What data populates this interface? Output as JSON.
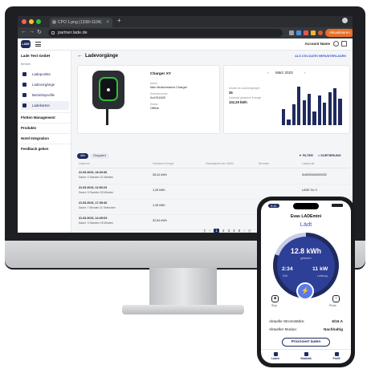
{
  "browser": {
    "tab_title": "CPO 1.png (1338×1104)",
    "tab_close": "×",
    "new_tab": "+",
    "url": "partner.lade.de",
    "update_label": "Aktualisieren"
  },
  "app": {
    "logo_text": "LADE",
    "account": "Account Name"
  },
  "sidebar": {
    "company": "Lade Test GmbH",
    "section_label": "Betrieb",
    "items": [
      {
        "label": "Ladepunkte",
        "icon": "charger-icon"
      },
      {
        "label": "Ladevorgänge",
        "icon": "list-icon"
      },
      {
        "label": "Betriebsprofile",
        "icon": "power-icon"
      },
      {
        "label": "Ladekarten",
        "icon": "card-icon"
      }
    ],
    "groups": [
      "Flotten Management",
      "Produkte",
      "Hotel Integration",
      "Feedback geben"
    ]
  },
  "main": {
    "title": "Ladevorgänge",
    "csv_link": "ALS CSV-DATEI HERUNTERLADEN",
    "charger": {
      "name": "Charger XY",
      "fields": [
        {
          "label": "Name",
          "value": "Max Mustermanns Charger"
        },
        {
          "label": "Seriennummer",
          "value": "0x4761625"
        },
        {
          "label": "Status",
          "value": "Offline"
        }
      ]
    },
    "stats": {
      "count_label": "Anzahl an Ladevorgängen",
      "count_value": "35",
      "energy_label": "Gesamte geladene Energie",
      "energy_value": "102,29 kWh",
      "month": "März 2023",
      "prev": "‹",
      "next": "›"
    },
    "chips": [
      "Alle",
      "Gruppiert"
    ],
    "filter_label": "FILTER",
    "sort_label": "SORTIERUNG",
    "table": {
      "headers": [
        "Zeitpunkt",
        "Geladene Energie",
        "Gesamtpreis inkl. MwSt.",
        "Benutzer",
        "Ladepunkt"
      ],
      "rows": [
        {
          "date": "21.03.2023, 18:20:36",
          "duration": "Dauer: 4 Stunden 21 Minuten",
          "energy": "28,44 kWh",
          "point": "0x5925340000025"
        },
        {
          "date": "21.03.2023, 11:53:23",
          "duration": "Dauer: 5 Stunden 33 Minuten",
          "energy": "1,26 kWh",
          "point": "LADE Go 3"
        },
        {
          "date": "21.03.2023, 17:39:40",
          "duration": "Dauer: 7 Minuten 21 Sekunden",
          "energy": "1,26 kWh",
          "point": "LADE Go 1"
        },
        {
          "date": "21.03.2023, 14:29:03",
          "duration": "Dauer: 3 Stunden 15 Minuten",
          "energy": "32,64 kWh",
          "point": ""
        }
      ]
    },
    "pager": [
      "|‹",
      "‹",
      "1",
      "2",
      "3",
      "4",
      "5",
      "›",
      "›|"
    ]
  },
  "chart_data": {
    "type": "bar",
    "title": "März 2023",
    "values": [
      9,
      3,
      12,
      22,
      14,
      18,
      8,
      17,
      13,
      19,
      21,
      15
    ]
  },
  "phone": {
    "time": "9:41",
    "title": "Evas LADEmini",
    "state": "Lädt",
    "energy": "12.8 kWh",
    "energy_label": "geladen",
    "duration": "2:34",
    "duration_label": "Zeit",
    "power": "11 kW",
    "power_label": "Leistung",
    "stop_label": "Stop",
    "photo_label": "Photo",
    "info": [
      {
        "label": "Aktuelle Stromstärke:",
        "value": "6/16 A"
      },
      {
        "label": "Aktueller Modus:",
        "value": "Nachhaltig"
      }
    ],
    "prio_button": "Priorisiert laden",
    "nav": [
      "Laden",
      "Statistik",
      "Profil"
    ]
  },
  "colors": {
    "brand": "#1f2a5e",
    "accent": "#3b55c6",
    "charger_ring": "#2fbf3a",
    "update_button": "#e8702a"
  }
}
